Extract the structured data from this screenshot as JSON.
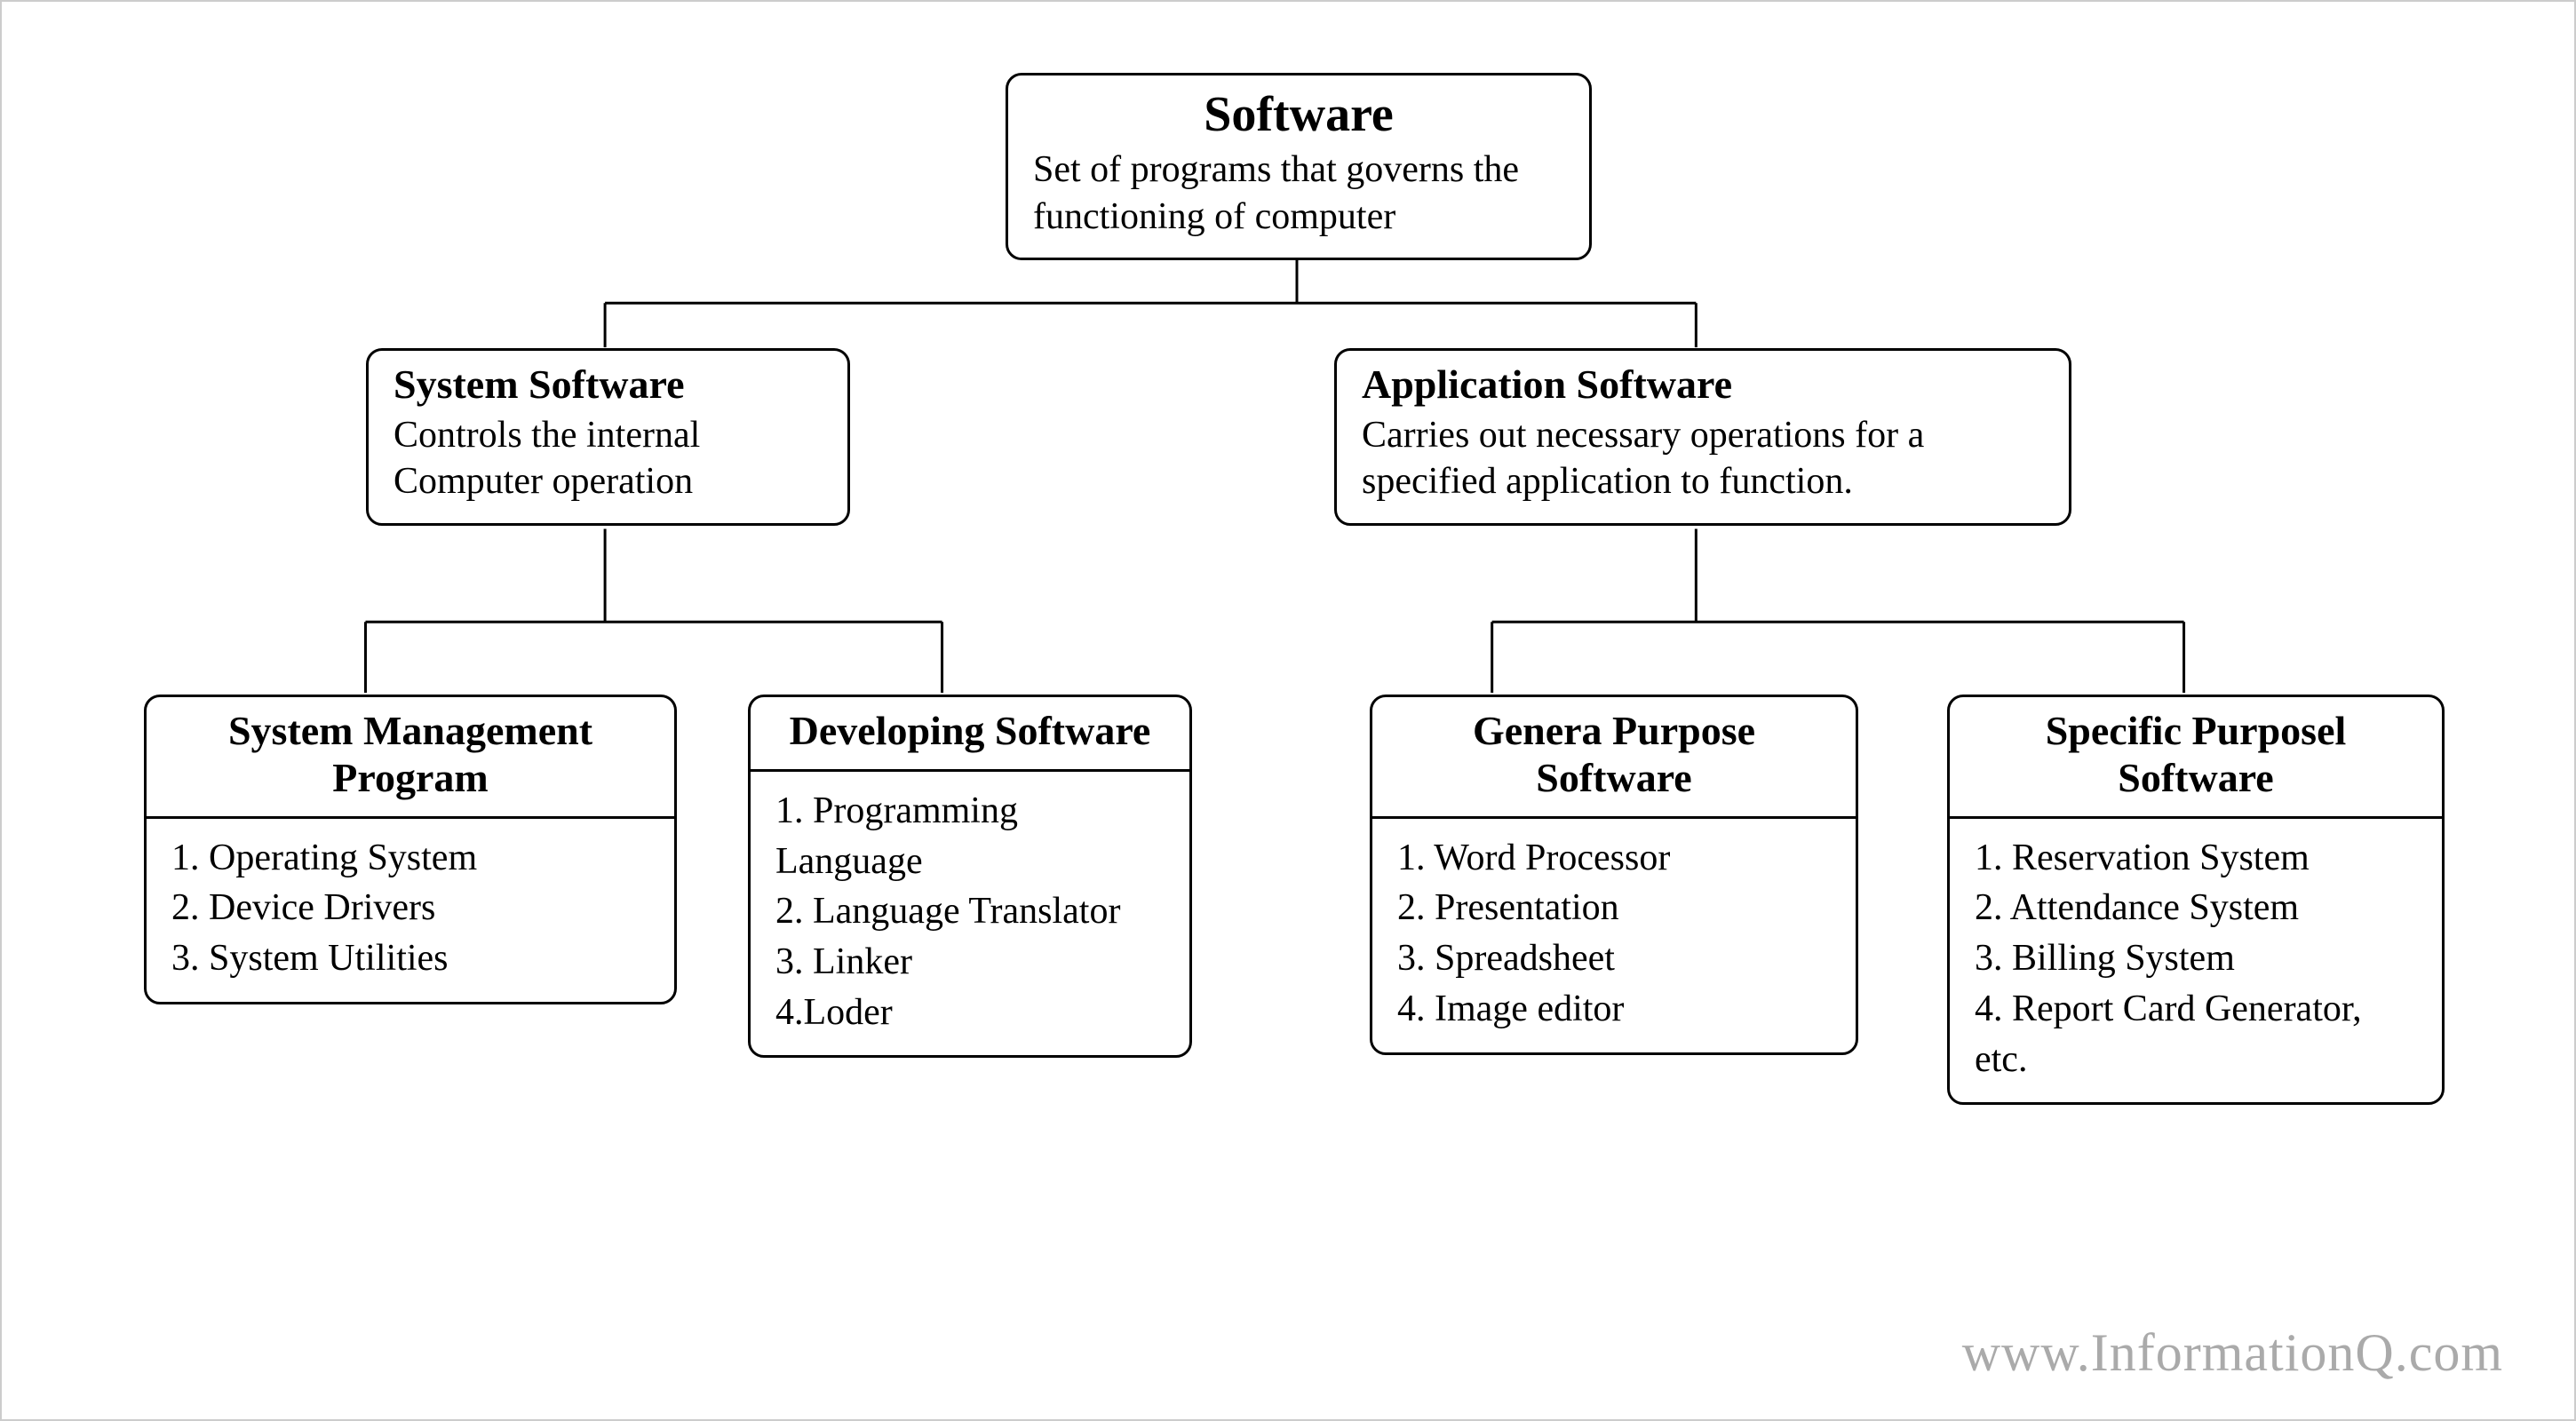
{
  "root": {
    "title": "Software",
    "subtitle": "Set of programs that governs the  functioning of computer"
  },
  "sys": {
    "title": "System Software",
    "subtitle": "Controls the internal Computer operation"
  },
  "app": {
    "title": "Application Software",
    "subtitle": "Carries out necessary operations for a specified application to function."
  },
  "smp": {
    "title": "System Management Program",
    "items": "1. Operating System\n2. Device Drivers\n3. System Utilities"
  },
  "dev": {
    "title": "Developing Software",
    "items": "1. Programming Language\n2. Language Translator\n3. Linker\n4.Loder"
  },
  "gen": {
    "title": "Genera Purpose Software",
    "items": "1. Word Processor\n2. Presentation\n3. Spreadsheet\n4. Image editor"
  },
  "spec": {
    "title": "Specific Purposel Software",
    "items": "1. Reservation System\n2. Attendance System\n3. Billing System\n4. Report Card Generator, etc."
  },
  "watermark": "www.InformationQ.com"
}
